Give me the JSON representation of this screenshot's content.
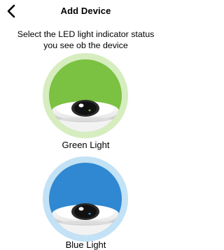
{
  "header": {
    "title": "Add Device",
    "back_icon": "chevron-left-icon"
  },
  "instruction": {
    "line1": "Select the LED light indicator status",
    "line2": "you see ob the device"
  },
  "options": [
    {
      "label": "Green Light",
      "ring_color": "#d6edbf",
      "fill_color": "#7bc142",
      "icon": "device-green-led-icon"
    },
    {
      "label": "Blue Light",
      "ring_color": "#c3e2f5",
      "fill_color": "#2f88d1",
      "icon": "device-blue-led-icon"
    }
  ]
}
